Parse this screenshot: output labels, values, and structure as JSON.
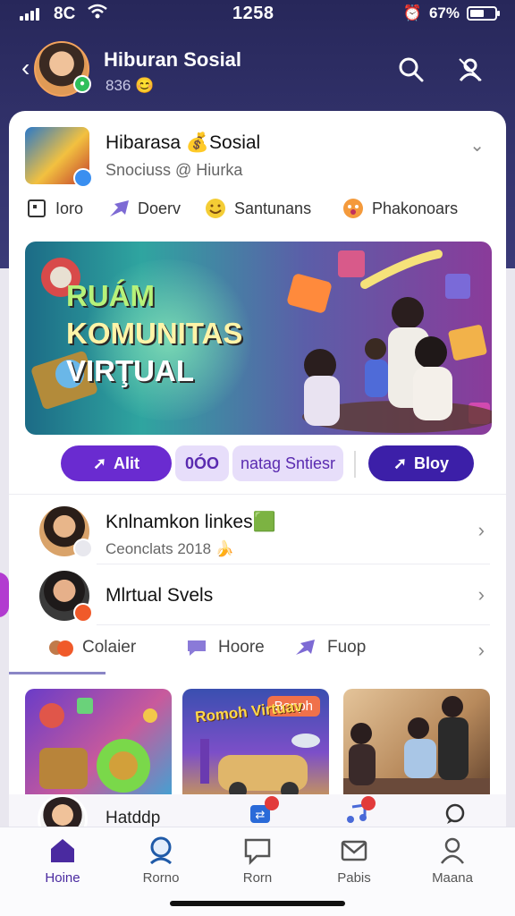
{
  "status_bar": {
    "carrier": "8C",
    "time": "1258",
    "battery_text": "67%",
    "battery_level": 0.62
  },
  "header": {
    "title": "Hiburan Sosial",
    "subtitle": "836 😊"
  },
  "group": {
    "title": "Hibarasa 💰Sosial",
    "subtitle": "Snociuss @ Hiurka",
    "chips": [
      {
        "label": "Ioro",
        "icon": "square-icon"
      },
      {
        "label": "Doerv",
        "icon": "arrow-icon"
      },
      {
        "label": "Santunans",
        "icon": "smiley-icon"
      },
      {
        "label": "Phakonoars",
        "icon": "emoji-icon"
      }
    ]
  },
  "hero": {
    "line1": "RUÁM",
    "line2": "KOMUNITAS",
    "line3": "VIRŢUAL"
  },
  "actions": {
    "primary": "Alit",
    "code": "0ÓO",
    "soft": "natag Sntiesr",
    "right": "Bloy"
  },
  "list": [
    {
      "title": "Knlnamkon linkes🟩",
      "subtitle": "Ceonclats 2018 🍌"
    },
    {
      "title": "Mlrtual Svels",
      "subtitle": ""
    }
  ],
  "sub_tabs": [
    {
      "label": "Colaier",
      "icon": "avatars-icon"
    },
    {
      "label": "Hoore",
      "icon": "chat-bubble-icon"
    },
    {
      "label": "Fuop",
      "icon": "arrow-icon"
    }
  ],
  "thumbs": [
    {
      "tag": "",
      "label": ""
    },
    {
      "tag": "Bonph",
      "label": "Romoh Virtuav"
    },
    {
      "tag": "",
      "label": ""
    }
  ],
  "story": {
    "label": "Hatddp"
  },
  "bottom_nav": [
    {
      "label": "Hoine",
      "icon": "home-icon",
      "active": true
    },
    {
      "label": "Rorno",
      "icon": "group-icon",
      "active": false
    },
    {
      "label": "Rorn",
      "icon": "chat-icon",
      "active": false
    },
    {
      "label": "Pabis",
      "icon": "mail-icon",
      "active": false
    },
    {
      "label": "Maana",
      "icon": "profile-icon",
      "active": false
    }
  ],
  "colors": {
    "header_bg": "#2b2b64",
    "accent": "#6a2bd0",
    "accent_dark": "#3c1fa8",
    "online": "#2fbf5b"
  }
}
